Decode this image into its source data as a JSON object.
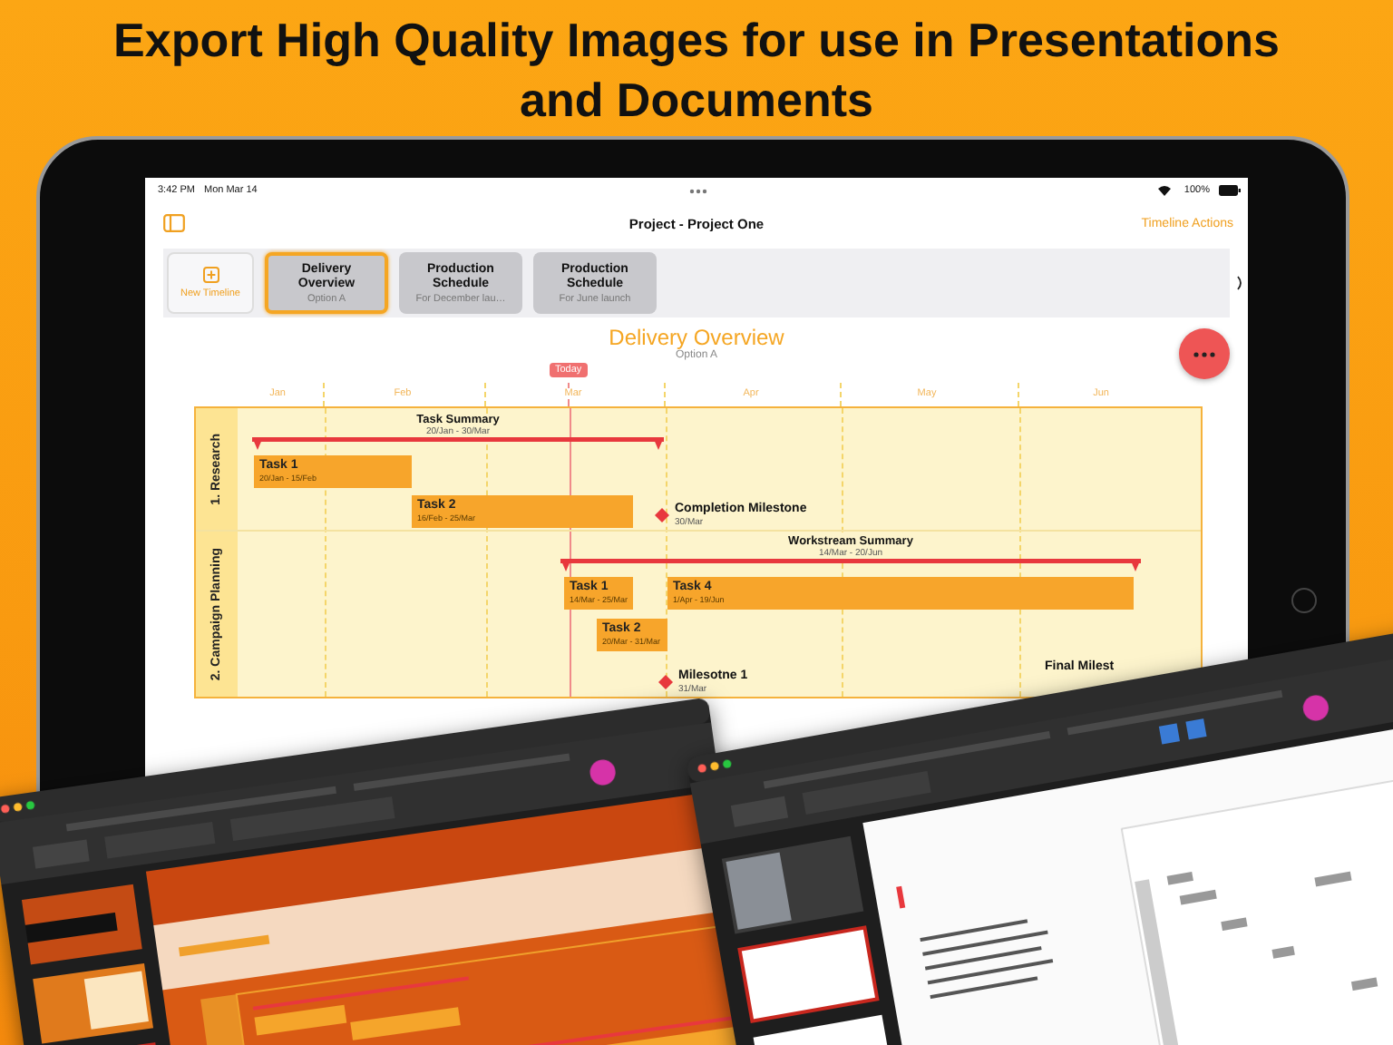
{
  "headline": "Export High Quality Images for use in Presentations and Documents",
  "status_bar": {
    "time": "3:42 PM",
    "date": "Mon Mar 14",
    "battery": "100%"
  },
  "nav": {
    "title": "Project - Project One",
    "action": "Timeline Actions"
  },
  "timelines": {
    "new_label": "New Timeline",
    "items": [
      {
        "title": "Delivery Overview",
        "subtitle": "Option A",
        "selected": true
      },
      {
        "title": "Production Schedule",
        "subtitle": "For December lau…",
        "selected": false
      },
      {
        "title": "Production Schedule",
        "subtitle": "For June launch",
        "selected": false
      }
    ]
  },
  "chart": {
    "title": "Delivery Overview",
    "subtitle": "Option A",
    "today": "Today",
    "months": [
      "Jan",
      "Feb",
      "Mar",
      "Apr",
      "May",
      "Jun"
    ],
    "lanes": [
      {
        "name": "1. Research",
        "items": [
          {
            "kind": "summary",
            "name": "Task Summary",
            "dates": "20/Jan - 30/Mar"
          },
          {
            "kind": "task",
            "name": "Task 1",
            "dates": "20/Jan - 15/Feb"
          },
          {
            "kind": "task",
            "name": "Task 2",
            "dates": "16/Feb - 25/Mar"
          },
          {
            "kind": "milestone",
            "name": "Completion Milestone",
            "dates": "30/Mar"
          }
        ]
      },
      {
        "name": "2. Campaign Planning",
        "items": [
          {
            "kind": "summary",
            "name": "Workstream Summary",
            "dates": "14/Mar - 20/Jun"
          },
          {
            "kind": "task",
            "name": "Task 1",
            "dates": "14/Mar - 25/Mar"
          },
          {
            "kind": "task",
            "name": "Task 4",
            "dates": "1/Apr - 19/Jun"
          },
          {
            "kind": "task",
            "name": "Task 2",
            "dates": "20/Mar - 31/Mar"
          },
          {
            "kind": "milestone",
            "name": "Milesotne 1",
            "dates": "31/Mar"
          },
          {
            "kind": "label",
            "name": "Final Milest"
          }
        ]
      }
    ]
  }
}
